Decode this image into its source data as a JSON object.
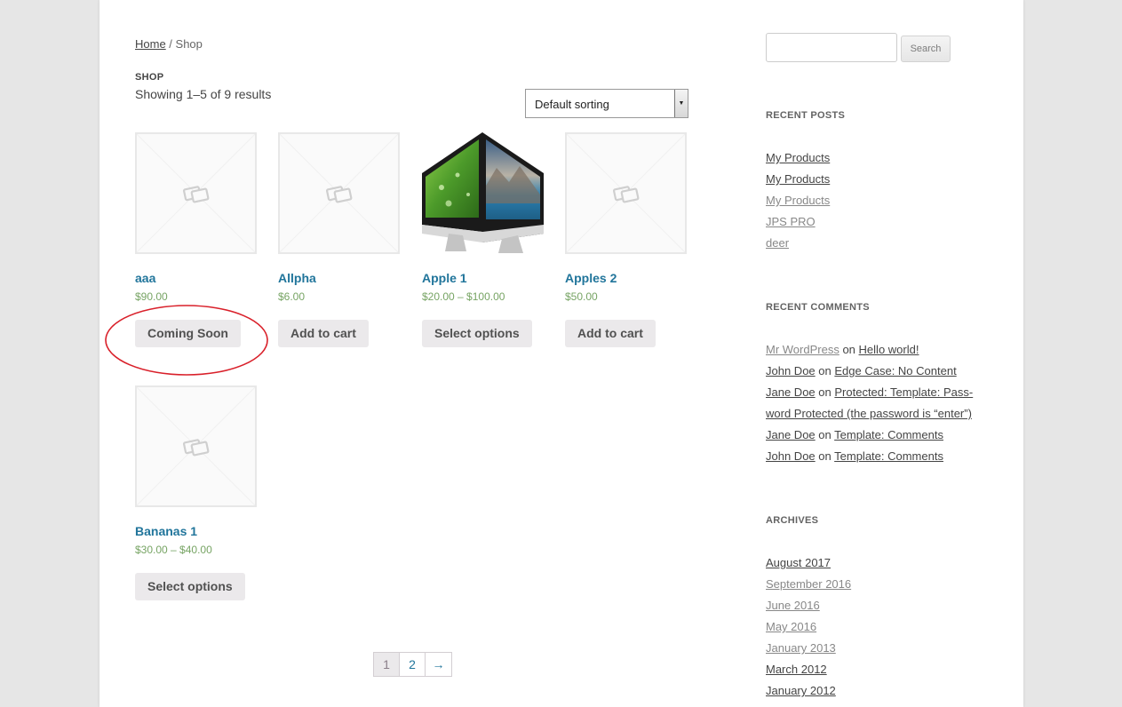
{
  "breadcrumb": {
    "home": "Home",
    "separator": " / ",
    "current": "Shop"
  },
  "shop": {
    "title": "SHOP",
    "result_count": "Showing 1–5 of 9 results",
    "sorting": "Default sorting"
  },
  "products": [
    {
      "name": "aaa",
      "price": "$90.00",
      "button": "Coming Soon",
      "image": "placeholder-image-icon"
    },
    {
      "name": "Allpha",
      "price": "$6.00",
      "button": "Add to cart",
      "image": "placeholder-image-icon"
    },
    {
      "name": "Apple 1",
      "price": "$20.00 – $100.00",
      "button": "Select options",
      "image": "imac-product-photo"
    },
    {
      "name": "Apples 2",
      "price": "$50.00",
      "button": "Add to cart",
      "image": "placeholder-image-icon"
    },
    {
      "name": "Bananas 1",
      "price": "$30.00 – $40.00",
      "button": "Select options",
      "image": "placeholder-image-icon"
    }
  ],
  "pagination": {
    "current": "1",
    "next_page": "2",
    "next_arrow": "→"
  },
  "sidebar": {
    "search_button": "Search",
    "recent_posts": {
      "title": "RECENT POSTS",
      "items": [
        "My Products",
        "My Products",
        "My Products",
        "JPS PRO",
        "deer"
      ]
    },
    "recent_comments": {
      "title": "RECENT COMMENTS",
      "on_word": "on",
      "items": [
        {
          "author": "Mr WordPress",
          "post": "Hello world!"
        },
        {
          "author": "John Doe",
          "post": "Edge Case: No Content"
        },
        {
          "author": "Jane Doe",
          "post": "Protected: Template: Pass-"
        },
        {
          "post_cont": "word Protected (the password is “enter”)"
        },
        {
          "author": "Jane Doe",
          "post": "Template: Comments"
        },
        {
          "author": "John Doe",
          "post": "Template: Comments"
        }
      ]
    },
    "archives": {
      "title": "ARCHIVES",
      "items": [
        "August 2017",
        "September 2016",
        "June 2016",
        "May 2016",
        "January 2013",
        "March 2012",
        "January 2012"
      ]
    }
  },
  "colors": {
    "link": "#21759b",
    "price": "#77a464",
    "button_bg": "#ebe9eb",
    "annotation": "#d9202a"
  }
}
